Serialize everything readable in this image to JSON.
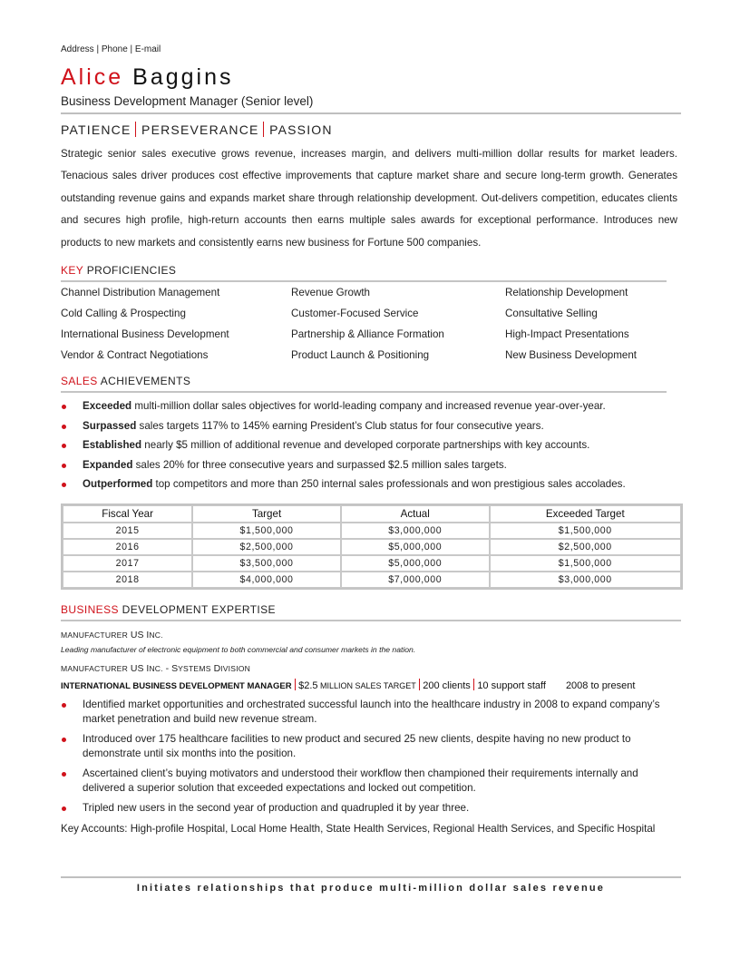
{
  "header": {
    "contact": "Address | Phone | E-mail",
    "first_name": "Alice",
    "last_name": "Baggins",
    "role": "Business Development Manager (Senior level)",
    "traits": [
      "PATIENCE",
      "PERSEVERANCE",
      "PASSION"
    ]
  },
  "summary": "Strategic senior sales executive grows revenue, increases margin, and delivers multi-million dollar results for market leaders. Tenacious sales driver produces cost effective improvements that capture market share and secure long-term growth. Generates outstanding revenue gains and expands market share through relationship development. Out-delivers competition, educates clients and secures high profile, high-return accounts then earns multiple sales awards for exceptional performance. Introduces new products to new markets and consistently earns new business for Fortune 500 companies.",
  "proficiencies": {
    "title_accent": "KEY",
    "title_rest": " PROFICIENCIES",
    "rows": [
      [
        "Channel Distribution Management",
        "Revenue Growth",
        "Relationship Development"
      ],
      [
        "Cold Calling & Prospecting",
        "Customer-Focused Service",
        "Consultative Selling"
      ],
      [
        "International Business Development",
        "Partnership & Alliance Formation",
        "High-Impact Presentations"
      ],
      [
        "Vendor & Contract Negotiations",
        "Product Launch & Positioning",
        "New Business Development"
      ]
    ]
  },
  "achievements": {
    "title_accent": "SALES",
    "title_rest": " ACHIEVEMENTS",
    "items": [
      {
        "lead": "Exceeded",
        "text": " multi-million dollar sales objectives for world-leading company and increased revenue year-over-year."
      },
      {
        "lead": "Surpassed",
        "text": " sales targets 117% to 145% earning President’s Club status for four consecutive years."
      },
      {
        "lead": "Established",
        "text": " nearly $5 million of additional revenue and developed corporate partnerships with key accounts."
      },
      {
        "lead": "Expanded",
        "text": " sales 20% for three consecutive years and surpassed $2.5 million sales targets."
      },
      {
        "lead": "Outperformed",
        "text": " top competitors and more than 250 internal sales professionals and won prestigious sales accolades."
      }
    ],
    "table": {
      "headers": [
        "Fiscal Year",
        "Target",
        "Actual",
        "Exceeded Target"
      ],
      "rows": [
        [
          "2015",
          "$1,500,000",
          "$3,000,000",
          "$1,500,000"
        ],
        [
          "2016",
          "$2,500,000",
          "$5,000,000",
          "$2,500,000"
        ],
        [
          "2017",
          "$3,500,000",
          "$5,000,000",
          "$1,500,000"
        ],
        [
          "2018",
          "$4,000,000",
          "$7,000,000",
          "$3,000,000"
        ]
      ]
    }
  },
  "expertise": {
    "title_accent": "BUSINESS",
    "title_rest": " DEVELOPMENT EXPERTISE",
    "company1": {
      "prefix": "MANUFACTURER",
      "name_big": " US I",
      "name_small": "NC."
    },
    "company1_desc": "Leading manufacturer of electronic equipment to both commercial and consumer markets in the nation.",
    "company2": {
      "prefix": "MANUFACTURER",
      "name_big": " US I",
      "name_small": "NC.",
      "division_big1": " - S",
      "division_small1": "YSTEMS",
      "division_big2": " D",
      "division_small2": "IVISION"
    },
    "job": {
      "title": "INTERNATIONAL BUSINESS DEVELOPMENT MANAGER",
      "target_num": "$2.5",
      "target_text": " MILLION SALES TARGET",
      "clients": "200 clients",
      "staff": "10 support staff",
      "dates": "2008 to present"
    },
    "bullets": [
      "Identified market opportunities and orchestrated successful launch into the healthcare industry in 2008 to expand company’s market penetration and build new revenue stream.",
      "Introduced over 175 healthcare facilities to new product and secured 25 new clients, despite having no new product to demonstrate until six months into the position.",
      "Ascertained client’s buying motivators and understood their workflow then championed their requirements internally and delivered a superior solution that exceeded expectations and locked out competition.",
      "Tripled new users in the second year of production and quadrupled it by year three."
    ],
    "key_accounts": "Key Accounts: High-profile Hospital, Local Home Health, State Health Services, Regional Health Services, and Specific Hospital"
  },
  "footer": {
    "tagline": "Initiates relationships that produce multi-million dollar sales revenue"
  },
  "colors": {
    "accent": "#d0121b",
    "rule": "#bfbfbf"
  }
}
